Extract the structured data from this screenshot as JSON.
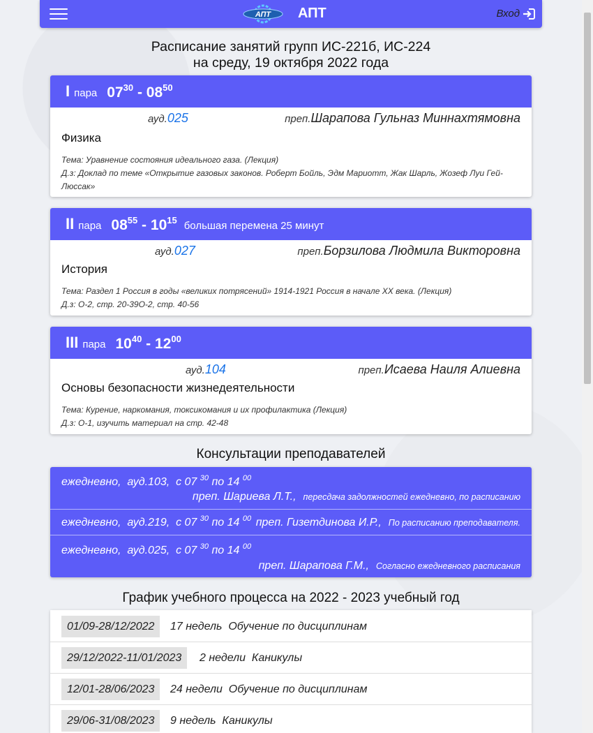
{
  "nav": {
    "brand": "АПТ",
    "login_label": "Вход",
    "logo_text": "АПТ"
  },
  "title": {
    "line1": "Расписание занятий групп ИС-221б, ИС-224",
    "line2": "на среду, 19 октября 2022 года"
  },
  "lessons": [
    {
      "num": "I",
      "para": "пара",
      "start_h": "07",
      "start_m": "30",
      "end_h": "08",
      "end_m": "50",
      "note": "",
      "aud_prefix": "ауд.",
      "aud": "025",
      "prep_prefix": "преп.",
      "teacher": "Шарапова Гульназ Миннахтямовна",
      "subject": "Физика",
      "topic": "Тема: Уравнение состояния идеального газа. (Лекция)",
      "homework": "Д.з: Доклад по теме «Открытие газовых законов. Роберт Бойль, Эдм Мариотт, Жак Шарль, Жозеф Луи Гей-Люссак»"
    },
    {
      "num": "II",
      "para": "пара",
      "start_h": "08",
      "start_m": "55",
      "end_h": "10",
      "end_m": "15",
      "note": "большая перемена 25 минут",
      "aud_prefix": "ауд.",
      "aud": "027",
      "prep_prefix": "преп.",
      "teacher": "Борзилова Людмила Викторовна",
      "subject": "История",
      "topic": "Тема: Раздел 1 Россия в годы «великих потрясений» 1914-1921 Россия в начале XX века. (Лекция)",
      "homework": "Д.з: О-2, стр. 20-39О-2, стр. 40-56"
    },
    {
      "num": "III",
      "para": "пара",
      "start_h": "10",
      "start_m": "40",
      "end_h": "12",
      "end_m": "00",
      "note": "",
      "aud_prefix": "ауд.",
      "aud": "104",
      "prep_prefix": "преп.",
      "teacher": "Исаева Наиля Алиевна",
      "subject": "Основы безопасности жизнедеятельности",
      "topic": "Тема: Курение, наркомания, токсикомания и их профилактика (Лекция)",
      "homework": "Д.з: О-1, изучить материал на стр. 42-48"
    }
  ],
  "consult": {
    "title": "Консультации преподавателей",
    "rows": [
      {
        "freq": "ежедневно,",
        "aud": "ауд.103,",
        "from": "с 07",
        "from_m": "30",
        "to": "по 14",
        "to_m": "00",
        "teacher": "преп. Шариева Л.Т.,",
        "note": "пересдача задолжностей ежедневно, по расписанию"
      },
      {
        "freq": "ежедневно,",
        "aud": "ауд.219,",
        "from": "с 07",
        "from_m": "30",
        "to": "по 14",
        "to_m": "00",
        "teacher": "преп. Гизетдинова И.Р.,",
        "note": "По расписанию преподавателя."
      },
      {
        "freq": "ежедневно,",
        "aud": "ауд.025,",
        "from": "с 07",
        "from_m": "30",
        "to": "по 14",
        "to_m": "00",
        "teacher": "преп. Шарапова Г.М.,",
        "note": "Согласно ежедневного расписания"
      }
    ]
  },
  "schedule": {
    "title": "График учебного процесса на 2022 - 2023 учебный год",
    "rows": [
      {
        "dates": "01/09-28/12/2022",
        "weeks": "17 недель",
        "activity": "Обучение по дисциплинам"
      },
      {
        "dates": "29/12/2022-11/01/2023",
        "weeks": "2 недели",
        "activity": "Каникулы"
      },
      {
        "dates": "12/01-28/06/2023",
        "weeks": "24 недели",
        "activity": "Обучение по дисциплинам"
      },
      {
        "dates": "29/06-31/08/2023",
        "weeks": "9 недель",
        "activity": "Каникулы"
      }
    ]
  },
  "colors": {
    "accent": "#5c5cf8",
    "link": "#1a73e8"
  }
}
